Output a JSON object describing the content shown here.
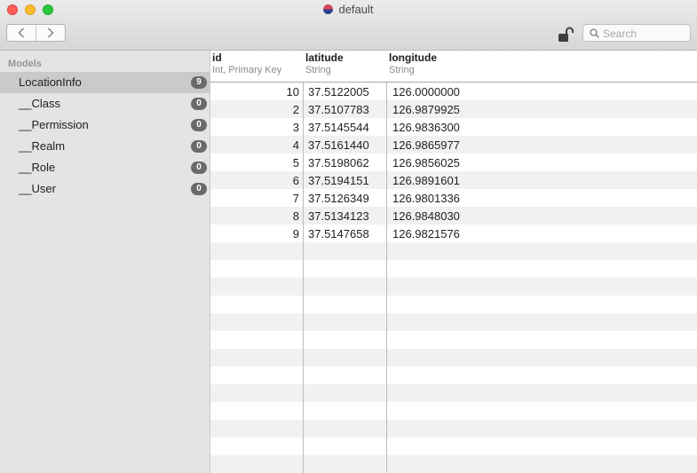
{
  "window": {
    "title": "default"
  },
  "search": {
    "placeholder": "Search"
  },
  "sidebar": {
    "heading": "Models",
    "items": [
      {
        "label": "LocationInfo",
        "count": "9",
        "selected": true
      },
      {
        "label": "__Class",
        "count": "0"
      },
      {
        "label": "__Permission",
        "count": "0"
      },
      {
        "label": "__Realm",
        "count": "0"
      },
      {
        "label": "__Role",
        "count": "0"
      },
      {
        "label": "__User",
        "count": "0"
      }
    ]
  },
  "table": {
    "columns": [
      {
        "name": "id",
        "type": "Int, Primary Key"
      },
      {
        "name": "latitude",
        "type": "String"
      },
      {
        "name": "longitude",
        "type": "String"
      }
    ],
    "rows": [
      {
        "id": "10",
        "latitude": "37.5122005",
        "longitude": "126.0000000"
      },
      {
        "id": "2",
        "latitude": "37.5107783",
        "longitude": "126.9879925"
      },
      {
        "id": "3",
        "latitude": "37.5145544",
        "longitude": "126.9836300"
      },
      {
        "id": "4",
        "latitude": "37.5161440",
        "longitude": "126.9865977"
      },
      {
        "id": "5",
        "latitude": "37.5198062",
        "longitude": "126.9856025"
      },
      {
        "id": "6",
        "latitude": "37.5194151",
        "longitude": "126.9891601"
      },
      {
        "id": "7",
        "latitude": "37.5126349",
        "longitude": "126.9801336"
      },
      {
        "id": "8",
        "latitude": "37.5134123",
        "longitude": "126.9848030"
      },
      {
        "id": "9",
        "latitude": "37.5147658",
        "longitude": "126.9821576"
      }
    ]
  }
}
